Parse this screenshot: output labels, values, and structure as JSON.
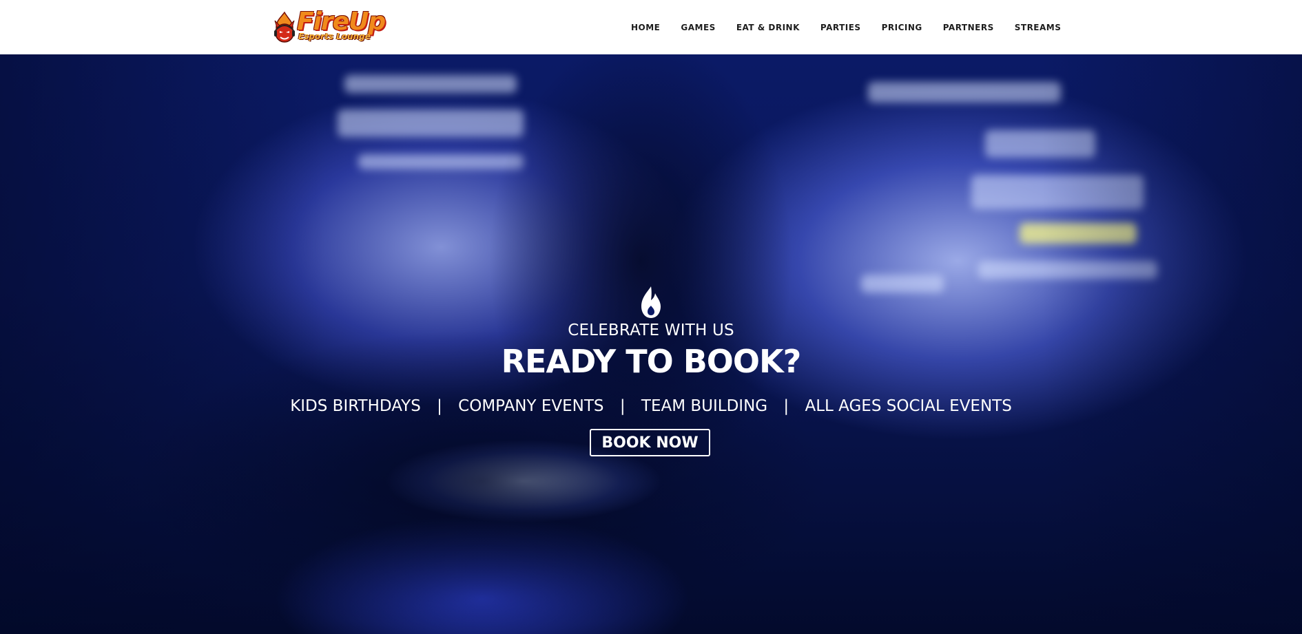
{
  "brand": {
    "logo_word": "FireUp",
    "logo_sub": "Esports Lounge",
    "logo_icon": "devil-mascot-icon",
    "colors": {
      "orange": "#f08a1c",
      "red": "#c21d12"
    }
  },
  "nav": {
    "items": [
      {
        "label": "HOME"
      },
      {
        "label": "GAMES"
      },
      {
        "label": "EAT & DRINK"
      },
      {
        "label": "PARTIES"
      },
      {
        "label": "PRICING"
      },
      {
        "label": "PARTNERS"
      },
      {
        "label": "STREAMS"
      }
    ]
  },
  "hero": {
    "icon": "flame-icon",
    "eyebrow": "CELEBRATE WITH US",
    "headline": "READY TO BOOK?",
    "events": [
      "KIDS BIRTHDAYS",
      "COMPANY EVENTS",
      "TEAM BUILDING",
      "ALL AGES SOCIAL EVENTS"
    ],
    "separator": "|",
    "cta_label": "BOOK NOW",
    "colors": {
      "text": "#ffffff",
      "background": "#0a175a"
    }
  }
}
